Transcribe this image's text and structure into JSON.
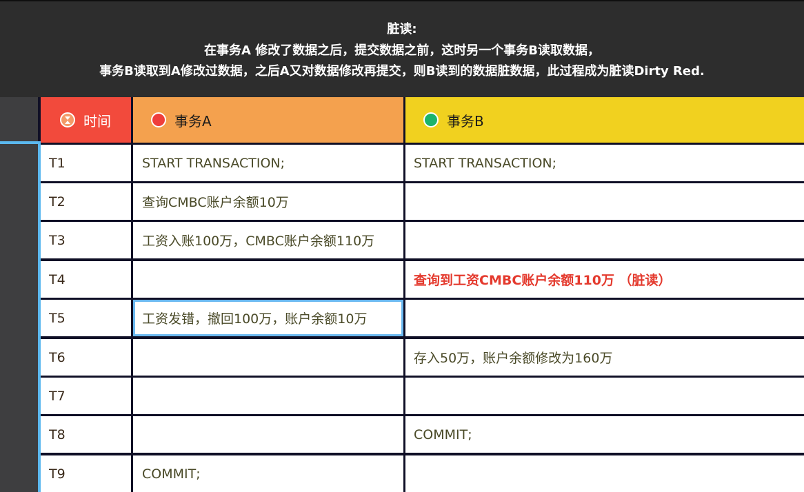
{
  "banner": {
    "title": "脏读:",
    "line1": "在事务A 修改了数据之后，提交数据之前，这时另一个事务B读取数据，",
    "line2": "事务B读取到A修改过数据，之后A又对数据修改再提交，则B读到的数据脏数据，此过程成为脏读Dirty Red."
  },
  "table": {
    "headers": {
      "time": "时间",
      "a": "事务A",
      "b": "事务B"
    },
    "rows": [
      {
        "t": "T1",
        "a": "START TRANSACTION;",
        "b": "START TRANSACTION;"
      },
      {
        "t": "T2",
        "a": "查询CMBC账户余额10万",
        "b": ""
      },
      {
        "t": "T3",
        "a": "工资入账100万，CMBC账户余额110万",
        "b": ""
      },
      {
        "t": "T4",
        "a": "",
        "b": "查询到工资CMBC账户余额110万  （脏读）"
      },
      {
        "t": "T5",
        "a": "工资发错，撤回100万，账户余额10万",
        "b": ""
      },
      {
        "t": "T6",
        "a": "",
        "b": "存入50万，账户余额修改为160万"
      },
      {
        "t": "T7",
        "a": "",
        "b": ""
      },
      {
        "t": "T8",
        "a": "",
        "b": "COMMIT;"
      },
      {
        "t": "T9",
        "a": "COMMIT;",
        "b": ""
      }
    ]
  },
  "icons": {
    "time": "hourglass-icon",
    "a": "red-dot-icon",
    "b": "green-dot-icon"
  },
  "colors": {
    "time_header": "#f24a3c",
    "a_header": "#f4a14e",
    "b_header": "#f1d11f",
    "highlight": "#e43a2e",
    "selection": "#6ab8f0"
  }
}
